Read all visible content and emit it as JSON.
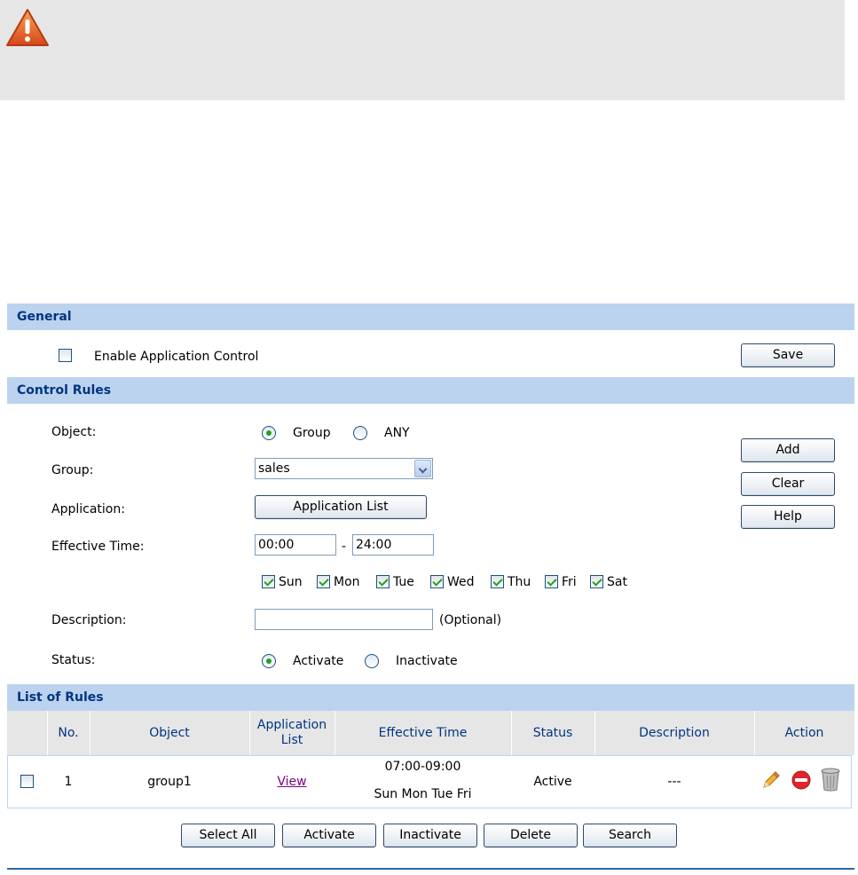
{
  "notice": {
    "icon": "warning-icon"
  },
  "general": {
    "title": "General",
    "enable_label": "Enable Application Control",
    "enable_checked": false,
    "save_button": "Save"
  },
  "control_rules": {
    "title": "Control Rules",
    "object_label": "Object:",
    "object_options": [
      "Group",
      "ANY"
    ],
    "object_selected": "Group",
    "group_label": "Group:",
    "group_value": "sales",
    "application_label": "Application:",
    "application_button": "Application List",
    "effective_time_label": "Effective Time:",
    "time_start": "00:00",
    "time_separator": "-",
    "time_end": "24:00",
    "days": [
      {
        "label": "Sun",
        "checked": true
      },
      {
        "label": "Mon",
        "checked": true
      },
      {
        "label": "Tue",
        "checked": true
      },
      {
        "label": "Wed",
        "checked": true
      },
      {
        "label": "Thu",
        "checked": true
      },
      {
        "label": "Fri",
        "checked": true
      },
      {
        "label": "Sat",
        "checked": true
      }
    ],
    "description_label": "Description:",
    "description_value": "",
    "description_hint": "(Optional)",
    "status_label": "Status:",
    "status_options": [
      "Activate",
      "Inactivate"
    ],
    "status_selected": "Activate",
    "add_button": "Add",
    "clear_button": "Clear",
    "help_button": "Help"
  },
  "list_of_rules": {
    "title": "List of Rules",
    "columns": [
      "No.",
      "Object",
      "Application List",
      "Effective Time",
      "Status",
      "Description",
      "Action"
    ],
    "rows": [
      {
        "checked": false,
        "no": "1",
        "object": "group1",
        "application_link": "View",
        "time": "07:00-09:00",
        "days": "Sun Mon Tue Fri",
        "status": "Active",
        "description": "---",
        "actions": [
          "edit-pencil-icon",
          "disable-icon",
          "delete-trash-icon"
        ]
      }
    ],
    "buttons": [
      "Select All",
      "Activate",
      "Inactivate",
      "Delete",
      "Search"
    ]
  }
}
